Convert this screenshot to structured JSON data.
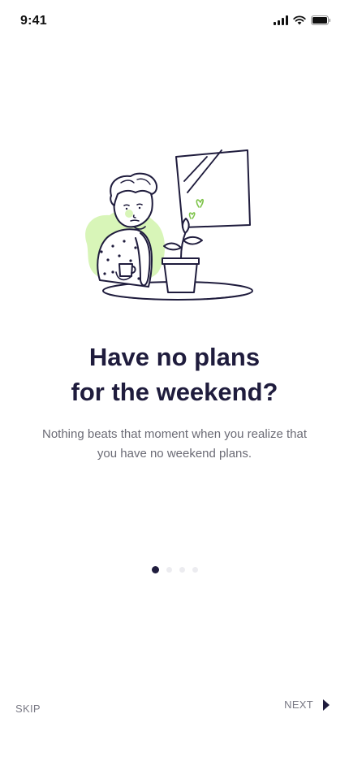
{
  "status_bar": {
    "time": "9:41",
    "icons": [
      "signal-icon",
      "wifi-icon",
      "battery-icon"
    ]
  },
  "illustration": {
    "icon": "person-with-plant-illustration",
    "accent_color": "#d8f5b8"
  },
  "onboarding": {
    "title_line1": "Have no plans",
    "title_line2": "for the weekend?",
    "subtitle_line1": "Nothing beats that moment when you realize that",
    "subtitle_line2": "you have no weekend plans."
  },
  "pager": {
    "total_pages": 4,
    "current_page": 1
  },
  "footer": {
    "skip_label": "SKIP",
    "next_label": "NEXT",
    "next_icon": "play-arrow-icon"
  },
  "colors": {
    "primary": "#1f1c3d",
    "muted_text": "#7a7a85",
    "inactive_dot": "#ececf0"
  }
}
